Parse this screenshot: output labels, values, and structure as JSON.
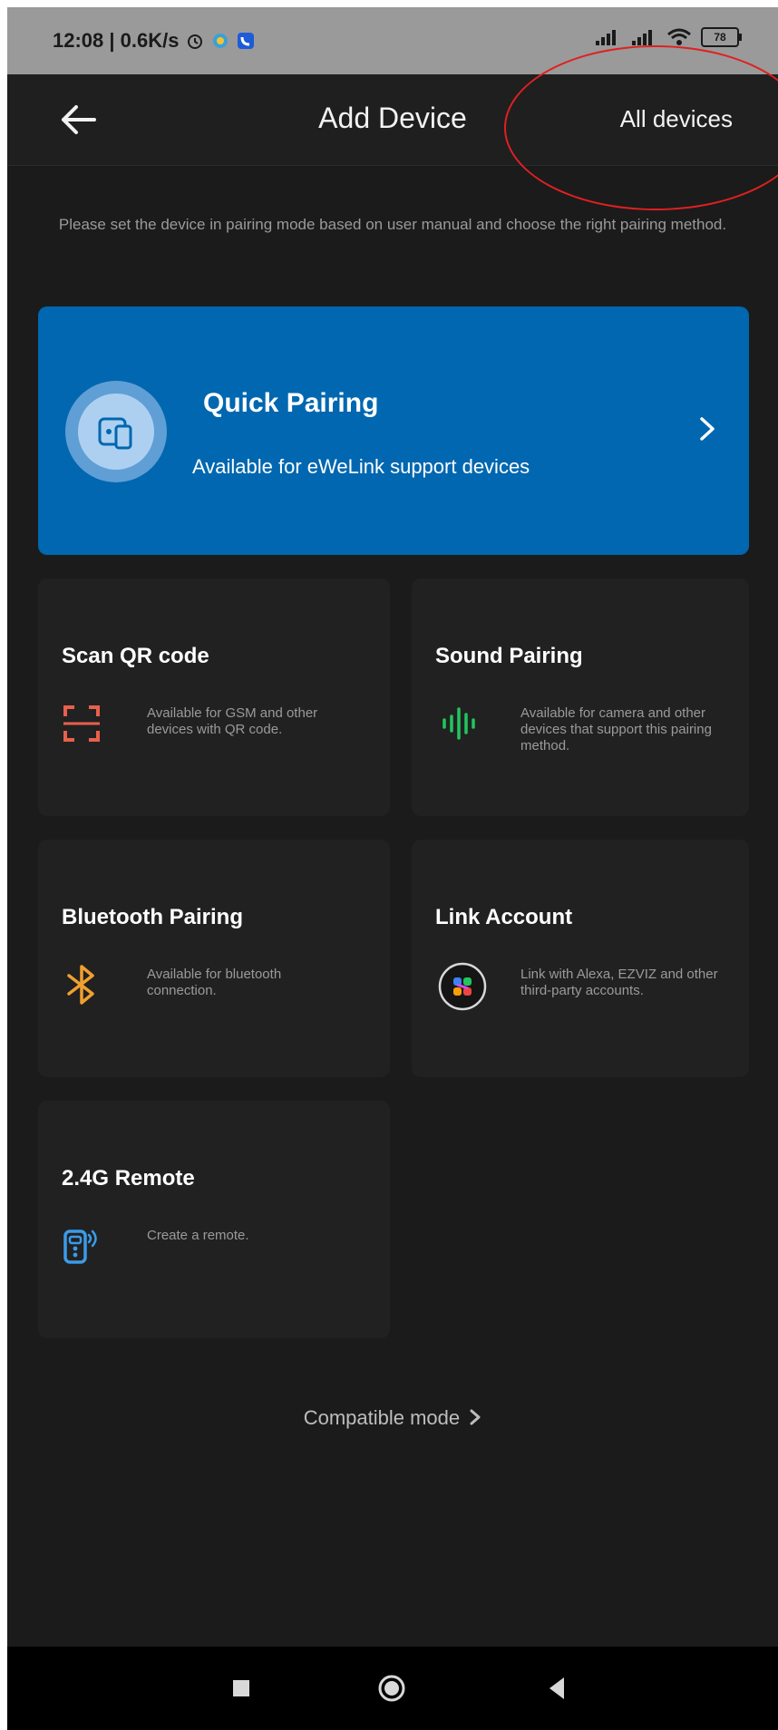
{
  "status_bar": {
    "left_text": "12:08 | 0.6K/s",
    "battery": "78"
  },
  "header": {
    "title": "Add Device",
    "all_devices_label": "All devices"
  },
  "instruction": "Please set the device in pairing mode based on user manual and choose the right pairing method.",
  "quick_pairing": {
    "title": "Quick Pairing",
    "subtitle": "Available for eWeLink support devices"
  },
  "cards": [
    {
      "title": "Scan QR code",
      "desc": "Available for GSM and other devices with QR code.",
      "icon": "qr-scan-icon"
    },
    {
      "title": "Sound Pairing",
      "desc": "Available for camera and other devices that support this pairing method.",
      "icon": "sound-wave-icon"
    },
    {
      "title": "Bluetooth Pairing",
      "desc": "Available for bluetooth connection.",
      "icon": "bluetooth-icon"
    },
    {
      "title": "Link Account",
      "desc": "Link with Alexa, EZVIZ and other third-party accounts.",
      "icon": "link-account-icon"
    },
    {
      "title": "2.4G Remote",
      "desc": "Create a remote.",
      "icon": "remote-icon"
    }
  ],
  "compatible_mode": "Compatible mode",
  "colors": {
    "accent_blue": "#0067b0",
    "qr_icon": "#e8604c",
    "sound_icon": "#22c55e",
    "bluetooth_icon": "#f0a030",
    "remote_icon": "#3b9be8",
    "annotation_red": "#e02020"
  }
}
